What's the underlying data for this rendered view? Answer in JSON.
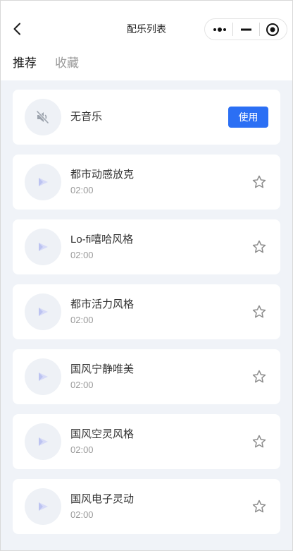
{
  "header": {
    "title": "配乐列表",
    "icons": {
      "back": "chevron-left-icon",
      "more": "more-dots-icon",
      "minimize": "minus-icon",
      "close": "target-icon"
    }
  },
  "tabs": [
    {
      "label": "推荐",
      "active": true
    },
    {
      "label": "收藏",
      "active": false
    }
  ],
  "no_music": {
    "label": "无音乐",
    "icon": "mute-speaker-icon",
    "use_button_label": "使用"
  },
  "tracks": [
    {
      "title": "都市动感放克",
      "duration": "02:00",
      "icon": "play-icon",
      "favorite": false
    },
    {
      "title": "Lo-fi嘻哈风格",
      "duration": "02:00",
      "icon": "play-icon",
      "favorite": false
    },
    {
      "title": "都市活力风格",
      "duration": "02:00",
      "icon": "play-icon",
      "favorite": false
    },
    {
      "title": "国风宁静唯美",
      "duration": "02:00",
      "icon": "play-icon",
      "favorite": false
    },
    {
      "title": "国风空灵风格",
      "duration": "02:00",
      "icon": "play-icon",
      "favorite": false
    },
    {
      "title": "国风电子灵动",
      "duration": "02:00",
      "icon": "play-icon",
      "favorite": false
    }
  ],
  "colors": {
    "accent": "#2b6ff4",
    "page_background": "#f0f3f8",
    "card_background": "#ffffff",
    "primary_text": "#333333",
    "secondary_text": "#9a9a9a",
    "inactive_tab": "#9a9a9a"
  }
}
